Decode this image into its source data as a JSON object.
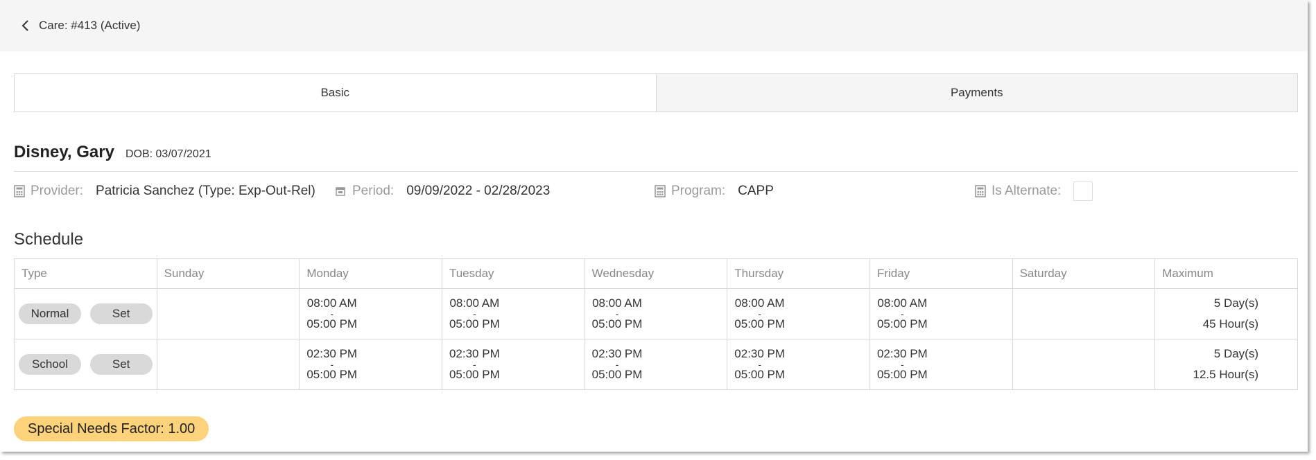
{
  "header": {
    "back_label": "Care: #413 (Active)"
  },
  "tabs": [
    {
      "label": "Basic",
      "active": true
    },
    {
      "label": "Payments",
      "active": false
    }
  ],
  "child": {
    "name": "Disney, Gary",
    "dob": "DOB: 03/07/2021"
  },
  "fields": {
    "provider": {
      "label": "Provider:",
      "value": "Patricia Sanchez (Type: Exp-Out-Rel)",
      "icon": "calculator-icon"
    },
    "period": {
      "label": "Period:",
      "value": "09/09/2022 - 02/28/2023",
      "icon": "calendar-icon"
    },
    "program": {
      "label": "Program:",
      "value": "CAPP",
      "icon": "calculator-icon"
    },
    "is_alternate": {
      "label": "Is Alternate:",
      "checked": false,
      "icon": "calculator-icon"
    }
  },
  "schedule": {
    "title": "Schedule",
    "columns": [
      "Type",
      "Sunday",
      "Monday",
      "Tuesday",
      "Wednesday",
      "Thursday",
      "Friday",
      "Saturday",
      "Maximum"
    ],
    "rows": [
      {
        "type": "Normal",
        "action": "Set",
        "days": {
          "sunday": {
            "start": "",
            "end": ""
          },
          "monday": {
            "start": "08:00 AM",
            "end": "05:00 PM"
          },
          "tuesday": {
            "start": "08:00 AM",
            "end": "05:00 PM"
          },
          "wednesday": {
            "start": "08:00 AM",
            "end": "05:00 PM"
          },
          "thursday": {
            "start": "08:00 AM",
            "end": "05:00 PM"
          },
          "friday": {
            "start": "08:00 AM",
            "end": "05:00 PM"
          },
          "saturday": {
            "start": "",
            "end": ""
          }
        },
        "max_days": "5 Day(s)",
        "max_hours": "45 Hour(s)"
      },
      {
        "type": "School",
        "action": "Set",
        "days": {
          "sunday": {
            "start": "",
            "end": ""
          },
          "monday": {
            "start": "02:30 PM",
            "end": "05:00 PM"
          },
          "tuesday": {
            "start": "02:30 PM",
            "end": "05:00 PM"
          },
          "wednesday": {
            "start": "02:30 PM",
            "end": "05:00 PM"
          },
          "thursday": {
            "start": "02:30 PM",
            "end": "05:00 PM"
          },
          "friday": {
            "start": "02:30 PM",
            "end": "05:00 PM"
          },
          "saturday": {
            "start": "",
            "end": ""
          }
        },
        "max_days": "5 Day(s)",
        "max_hours": "12.5 Hour(s)"
      }
    ],
    "separator": "-"
  },
  "special_needs": {
    "label": "Special Needs Factor: 1.00"
  },
  "colors": {
    "topbar": "#f5f5f5",
    "pill": "#d9d9d9",
    "factor_badge": "#fcd27a",
    "label_gray": "#999999"
  }
}
